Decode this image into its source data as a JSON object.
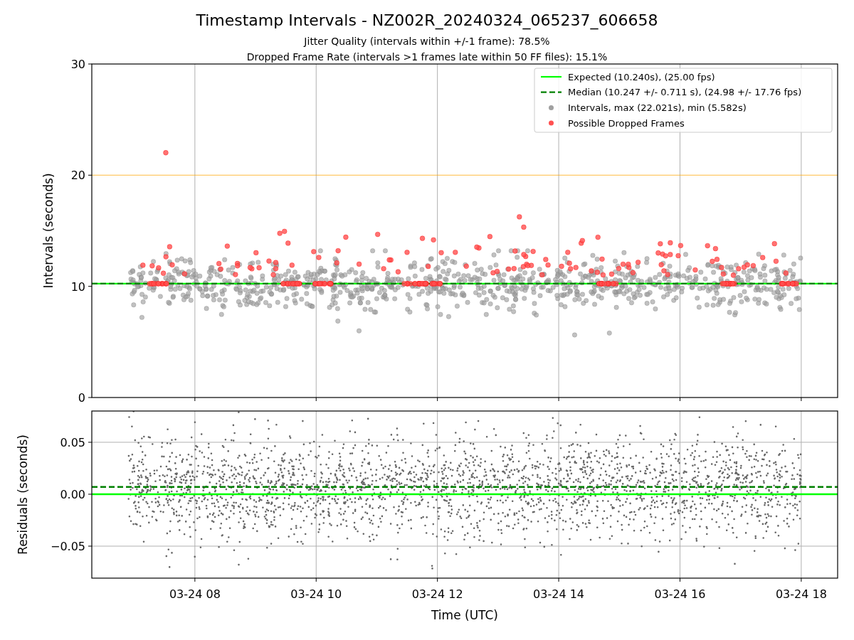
{
  "figure": {
    "title": "Timestamp Intervals - NZ002R_20240324_065237_606658",
    "subtitles": [
      "Jitter Quality (intervals within +/-1 frame): 78.5%",
      "Dropped Frame Rate (intervals >1 frames late within 50 FF files): 15.1%"
    ]
  },
  "intervals_panel": {
    "chart_data": {
      "type": "scatter",
      "ylabel": "Intervals (seconds)",
      "ylim": [
        0,
        30
      ],
      "grid": true,
      "categories": [
        null,
        null,
        null,
        null,
        null,
        null
      ],
      "yticks": [
        {
          "value": 0,
          "label": "0"
        },
        {
          "value": 10,
          "label": "10"
        },
        {
          "value": 20,
          "label": "20"
        },
        {
          "value": 30,
          "label": "30"
        }
      ],
      "ref_lines": [
        {
          "axis": "y",
          "value": 10.24,
          "label": "Expected (10.240s), (25.00 fps)",
          "color": "#00ff00"
        },
        {
          "axis": "y",
          "value": 10.247,
          "label": "Median (10.247 +/- 0.711 s), (24.98 +/- 17.76 fps)",
          "color": "#008000"
        },
        {
          "axis": "y",
          "value": 20,
          "color": "#ffa500"
        }
      ]
    },
    "point_sets": [
      {
        "name": "Intervals, max (22.021s), min (5.582s)",
        "color": "#a0a0a0",
        "kind": "intervals"
      },
      {
        "name": "Possible Dropped Frames",
        "color": "#ff5050",
        "kind": "dropped"
      }
    ]
  },
  "residuals_panel": {
    "chart_data": {
      "type": "scatter",
      "xlabel": "Time (UTC)",
      "ylabel": "Residuals (seconds)",
      "ylim": [
        -0.0808,
        0.0801
      ],
      "grid": true,
      "categories": [
        "03-24 08",
        "03-24 10",
        "03-24 12",
        "03-24 14",
        "03-24 16",
        "03-24 18"
      ],
      "yticks": [
        {
          "value": -0.05,
          "label": "−0.05"
        },
        {
          "value": 0,
          "label": "0.00"
        },
        {
          "value": 0.05,
          "label": "0.05"
        }
      ],
      "ref_lines": [
        {
          "axis": "y",
          "value": 0,
          "color": "#00ff00"
        },
        {
          "axis": "y",
          "value": 0.007,
          "color": "#008000"
        }
      ]
    }
  }
}
